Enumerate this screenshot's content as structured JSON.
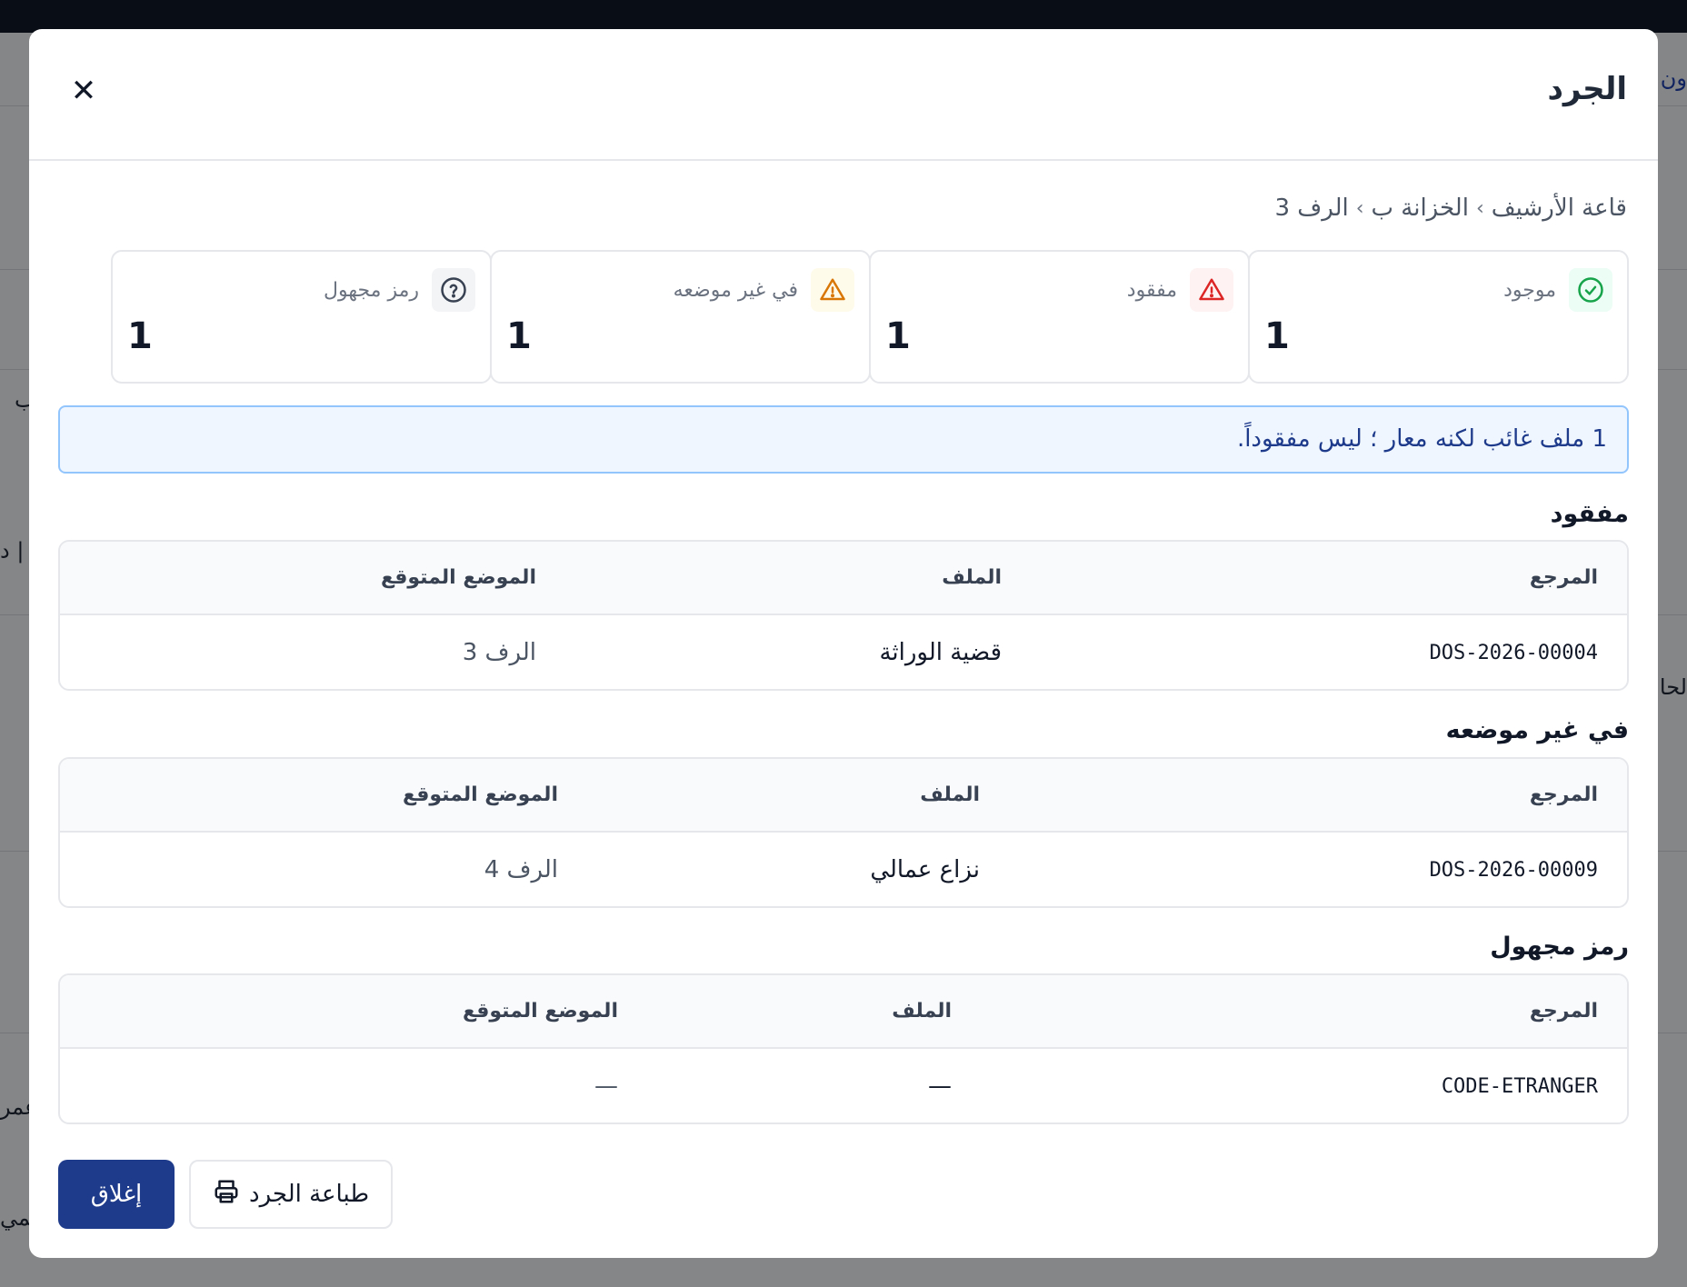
{
  "background": {
    "fragments": [
      "ون",
      "ب",
      "| د",
      "لحا",
      "عمر",
      "تمي"
    ]
  },
  "modal": {
    "title": "الجرد",
    "close_icon": "close-icon",
    "breadcrumb": [
      "قاعة الأرشيف",
      "الخزانة ب",
      "الرف 3"
    ],
    "stats": [
      {
        "label": "موجود",
        "value": "1",
        "icon": "check-circle-icon",
        "color": "#16a34a",
        "bg": "#ecfdf5"
      },
      {
        "label": "مفقود",
        "value": "1",
        "icon": "alert-triangle-icon",
        "color": "#dc2626",
        "bg": "#fef2f2"
      },
      {
        "label": "في غير موضعه",
        "value": "1",
        "icon": "alert-triangle-icon",
        "color": "#d97706",
        "bg": "#fffbeb"
      },
      {
        "label": "رمز مجهول",
        "value": "1",
        "icon": "help-circle-icon",
        "color": "#374151",
        "bg": "#f3f4f6"
      }
    ],
    "info_message": "1 ملف غائب لكنه معار ؛ ليس مفقوداً.",
    "sections": [
      {
        "title": "مفقود",
        "columns": [
          "المرجع",
          "الملف",
          "الموضع المتوقع"
        ],
        "rows": [
          {
            "ref": "DOS-2026-00004",
            "file": "قضية الوراثة",
            "expected": "الرف 3"
          }
        ]
      },
      {
        "title": "في غير موضعه",
        "columns": [
          "المرجع",
          "الملف",
          "الموضع المتوقع"
        ],
        "rows": [
          {
            "ref": "DOS-2026-00009",
            "file": "نزاع عمالي",
            "expected": "الرف 4"
          }
        ]
      },
      {
        "title": "رمز مجهول",
        "columns": [
          "المرجع",
          "الملف",
          "الموضع المتوقع"
        ],
        "rows": [
          {
            "ref": "CODE-ETRANGER",
            "file": "—",
            "expected": "—"
          }
        ]
      }
    ],
    "footer": {
      "close_label": "إغلاق",
      "print_label": "طباعة الجرد",
      "print_icon": "printer-icon"
    }
  }
}
